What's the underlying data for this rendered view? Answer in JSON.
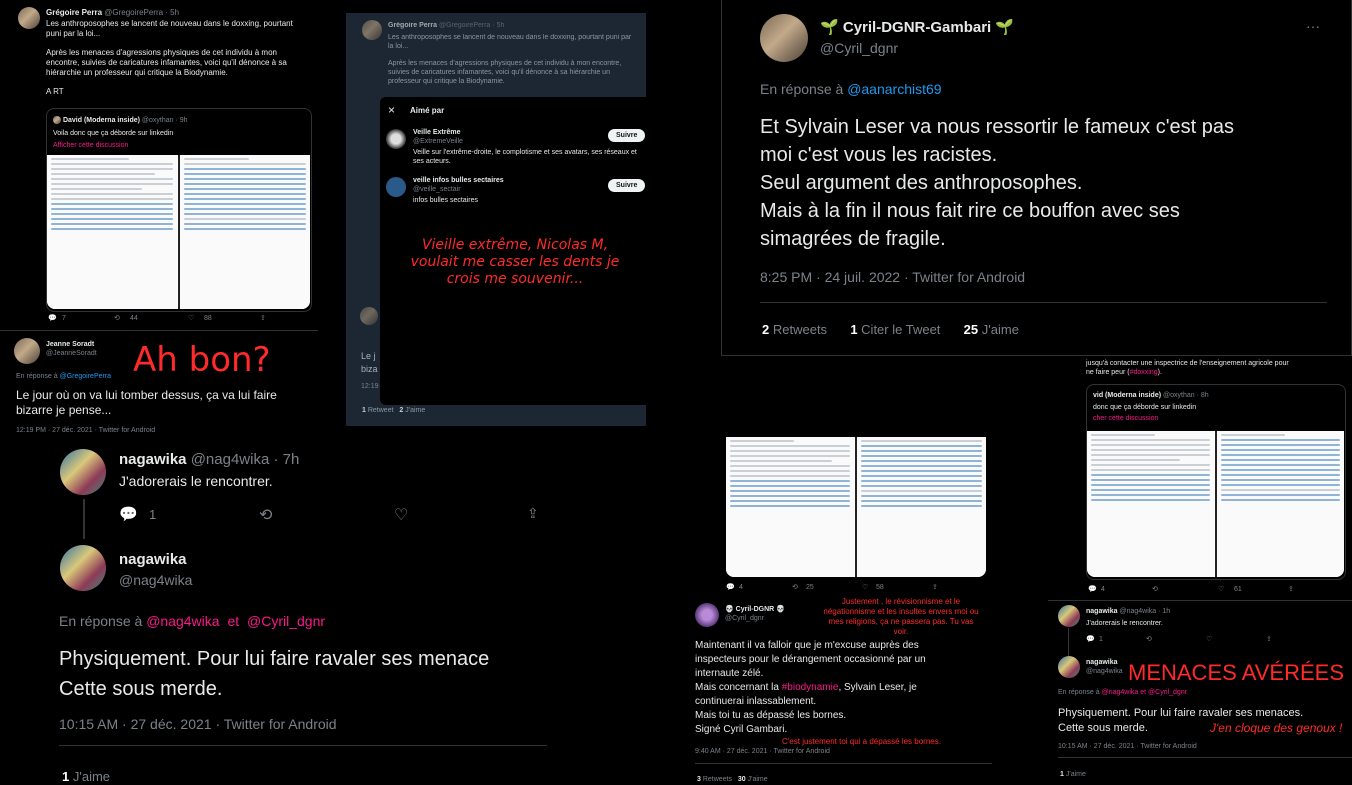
{
  "p1": {
    "name": "Grégoire Perra",
    "handle": "@GregoirePerra · 5h",
    "text1": "Les anthroposophes se lancent de nouveau dans le doxxing, pourtant puni par la loi...",
    "text2": "Après les menaces d'agressions physiques de cet individu à mon encontre, suivies de caricatures infamantes, voici qu'il dénonce à sa hiérarchie un professeur qui critique la Biodynamie.",
    "text3": "A RT",
    "quote_name": "David (Moderna inside)",
    "quote_handle": "@oxythan · 9h",
    "quote_text": "Voila donc que ça déborde sur linkedin",
    "quote_link": "Afficher cette discussion",
    "replies": "7",
    "retweets": "44",
    "likes": "88",
    "reply_name": "Jeanne Soradt",
    "reply_handle": "@JeanneSoradt",
    "reply_to_label": "En réponse à",
    "reply_to": "@GregoirePerra",
    "reply_text": "Le jour où on va lui tomber dessus, ça va lui faire bizarre je pense...",
    "reply_meta": "12:19 PM · 27 déc. 2021 · Twitter for Android",
    "annotation": "Ah bon?"
  },
  "p2": {
    "name": "Grégoire Perra",
    "handle": "@GregoirePerra · 5h",
    "text1": "Les anthroposophes se lancent de nouveau dans le doxxing, pourtant puni par la loi...",
    "text2": "Après les menaces d'agressions physiques de cet individu à mon encontre, suivies de caricatures infamantes, voici qu'il dénonce à sa hiérarchie un professeur qui critique la Biodynamie.",
    "side_text": "Le j\nbiza",
    "side_meta": "12:19",
    "footer_rt": "1",
    "footer_rt_label": "Retweet",
    "footer_likes": "2",
    "footer_likes_label": "J'aime",
    "modal_title": "Aimé par",
    "modal_close": "×",
    "user1_name": "Veille Extrême",
    "user1_handle": "@ExtremeVeille",
    "user1_bio": "Veille sur l'extrême-droite, le complotisme et ses avatars, ses réseaux et ses acteurs.",
    "user2_name": "veille infos bulles sectaires",
    "user2_handle": "@veille_sectair",
    "user2_bio": "infos bulles sectaires",
    "follow_label": "Suivre",
    "annotation": "Vieille extrême, Nicolas M, voulait me casser les dents je crois me souvenir..."
  },
  "p3": {
    "name": "Cyril-DGNR-Gambari",
    "sprout": "🌱",
    "handle": "@Cyril_dgnr",
    "more": "···",
    "reply_to_label": "En réponse à",
    "reply_to": "@aanarchist69",
    "lines": [
      "Et Sylvain Leser va nous ressortir le fameux c'est pas",
      "moi c'est vous les racistes.",
      "Seul argument des anthroposophes.",
      "Mais à la fin il nous fait rire ce bouffon avec ses",
      "simagrées de fragile."
    ],
    "meta": "8:25 PM · 24 juil. 2022 · Twitter for Android",
    "retweets": "2",
    "retweets_label": "Retweets",
    "quotes": "1",
    "quotes_label": "Citer le Tweet",
    "likes": "25",
    "likes_label": "J'aime"
  },
  "p4": {
    "name1": "nagawika",
    "handle1": "@nag4wika · 7h",
    "text1": "J'adorerais le rencontrer.",
    "replies1": "1",
    "name2": "nagawika",
    "handle2": "@nag4wika",
    "reply_to_label": "En réponse à",
    "reply_to1": "@nag4wika",
    "reply_to_and": "et",
    "reply_to2": "@Cyril_dgnr",
    "text2_l1": "Physiquement. Pour lui faire ravaler ses menace",
    "text2_l2": "Cette sous merde.",
    "meta": "10:15 AM · 27 déc. 2021 · Twitter for Android",
    "likes": "1",
    "likes_label": "J'aime"
  },
  "p5": {
    "replies": "4",
    "retweets": "25",
    "likes": "58",
    "name": "Cyril-DGNR",
    "skull": "💀",
    "handle": "@Cyril_dgnr",
    "annotation_top": "Justement , le révisionnisme et le négationnisme et les insultes envers moi ou mes religions, ça ne passera pas. Tu vas voir.",
    "text_l1": "Maintenant il va falloir que je m'excuse auprès des",
    "text_l2": "inspecteurs pour le dérangement occasionné par un",
    "text_l3": "internaute zélé.",
    "text_l4_pre": "Mais concernant la",
    "hashtag": "#biodynamie",
    "text_l4_post": ", Sylvain Leser, je",
    "text_l5": "continuerai inlassablement.",
    "text_l6": "Mais toi tu as dépassé les bornes.",
    "text_l7": "Signé Cyril Gambari.",
    "annotation_bottom": "C'est justement toi qui a dépassé les bornes.",
    "meta": "9:40 AM · 27 déc. 2021 · Twitter for Android",
    "retweets_count": "3",
    "retweets_label": "Retweets",
    "likes_count": "30",
    "likes_label": "J'aime"
  },
  "p6": {
    "top_text_l1": "jusqu'à contacter une inspectrice de l'enseignement agricole pour",
    "top_text_l2_pre": "ne faire peur (",
    "top_hashtag": "#doxxing",
    "top_text_l2_post": ").",
    "quote_name": "vid (Moderna inside)",
    "quote_handle": "@oxythan · 8h",
    "quote_text": "donc que ça déborde sur linkedin",
    "quote_link": "cher cette discussion",
    "replies": "4",
    "likes": "61",
    "name1": "nagawika",
    "handle1": "@nag4wika · 1h",
    "text1": "J'adorerais le rencontrer.",
    "replies1": "1",
    "name2": "nagawika",
    "handle2": "@nag4wika",
    "annotation": "MENACES AVÉRÉES",
    "reply_to_label": "En réponse à",
    "reply_to1": "@nag4wika",
    "reply_to_and": "et",
    "reply_to2": "@Cyril_dgnr",
    "text2_l1": "Physiquement. Pour lui faire ravaler ses menaces.",
    "text2_l2": "Cette sous merde.",
    "annotation2": "J'en cloque des genoux !",
    "meta": "10:15 AM · 27 déc. 2021 · Twitter for Android",
    "likes_count": "1",
    "likes_label": "J'aime"
  },
  "colors": {
    "link": "#1d9bf0",
    "annotation": "#ff2a2a",
    "pink": "#f9188a",
    "bg": "#000000",
    "dim": "#15202b"
  }
}
